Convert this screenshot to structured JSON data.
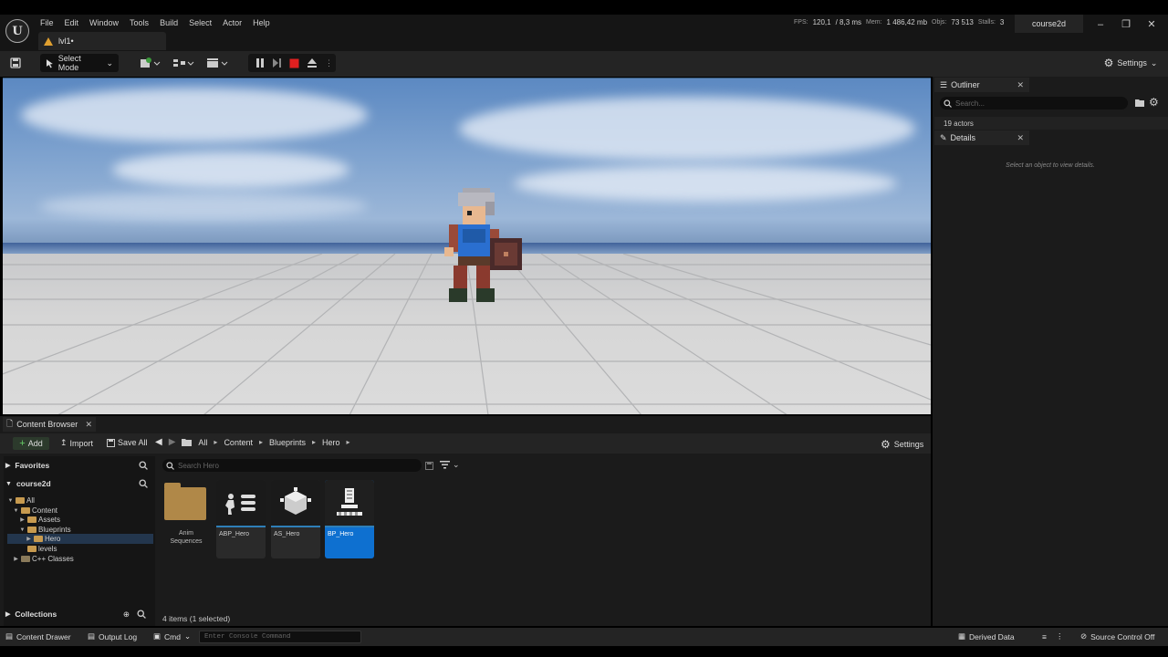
{
  "app": {
    "logo_text": "U"
  },
  "menu": [
    "File",
    "Edit",
    "Window",
    "Tools",
    "Build",
    "Select",
    "Actor",
    "Help"
  ],
  "level_tab": {
    "label": "lvl1•"
  },
  "stats": {
    "fps_label": "FPS:",
    "fps_value": "120,1",
    "ms_value": "/ 8,3 ms",
    "mem_label": "Mem:",
    "mem_value": "1 486,42 mb",
    "objs_label": "Objs:",
    "objs_value": "73 513",
    "stalls_label": "Stalls:",
    "stalls_value": "3"
  },
  "project_tab": "course2d",
  "window_controls": {
    "minimize": "–",
    "restore": "❐",
    "close": "✕"
  },
  "toolbar": {
    "select_mode": "Select Mode",
    "settings": "Settings"
  },
  "outliner": {
    "title": "Outliner",
    "search_placeholder": "Search...",
    "actor_count": "19 actors"
  },
  "details": {
    "title": "Details",
    "empty_message": "Select an object to view details."
  },
  "content_browser": {
    "tab_title": "Content Browser",
    "add": "Add",
    "import": "Import",
    "save_all": "Save All",
    "breadcrumb": [
      "All",
      "Content",
      "Blueprints",
      "Hero"
    ],
    "settings": "Settings",
    "search_placeholder": "Search Hero",
    "favorites": "Favorites",
    "project": "course2d",
    "collections": "Collections",
    "tree": {
      "all": "All",
      "content": "Content",
      "assets": "Assets",
      "blueprints": "Blueprints",
      "hero": "Hero",
      "levels": "levels",
      "cpp_classes": "C++ Classes"
    },
    "folder_tile": "Anim\nSequences",
    "assets": [
      "ABP_Hero",
      "AS_Hero",
      "BP_Hero"
    ],
    "selected_asset": "BP_Hero",
    "item_count": "4 items (1 selected)"
  },
  "statusbar": {
    "content_drawer": "Content Drawer",
    "output_log": "Output Log",
    "cmd": "Cmd",
    "console_placeholder": "Enter Console Command",
    "derived_data": "Derived Data",
    "source_control": "Source Control Off"
  },
  "colors": {
    "accent_blue": "#0e70d0",
    "stop_red": "#e02020",
    "folder": "#c79a4f"
  }
}
